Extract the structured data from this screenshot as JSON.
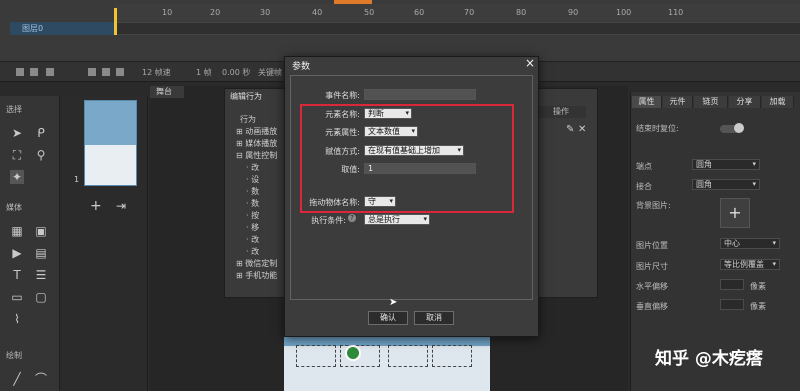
{
  "timeline": {
    "ticks": [
      "10",
      "20",
      "30",
      "40",
      "50",
      "60",
      "70",
      "80",
      "90",
      "100",
      "110"
    ],
    "layer_label": "图层0",
    "keyframe_color": "#f2c230",
    "bar": {
      "frames": "12 帧速",
      "current": "1 帧",
      "time": "0.00 秒",
      "keyframe_label": "关键帧"
    }
  },
  "left_tools": {
    "section_select": "选择",
    "section_media": "媒体",
    "section_draw": "绘制"
  },
  "pages": {
    "page_number": "1"
  },
  "canvas": {
    "tab_label": "舞台"
  },
  "behavior_editor": {
    "title": "编辑行为",
    "title_prefix": "行为",
    "tree": [
      "动画播放",
      "媒体播放",
      "属性控制",
      "改",
      "设",
      "数",
      "数",
      "按",
      "移",
      "改",
      "改",
      "固",
      "微信定制",
      "手机功能"
    ],
    "op_label": "操作"
  },
  "right_panel": {
    "tabs": [
      "属性",
      "元件",
      "链页",
      "分享",
      "加载"
    ],
    "rows": {
      "pos_label": "结束时复位:",
      "corner_label": "端点",
      "corner_value": "圆角",
      "join_label": "接合",
      "join_value": "圆角",
      "bg_label": "背景图片:",
      "bg_add": "+",
      "img_pos_label": "图片位置",
      "img_pos_value": "中心",
      "img_size_label": "图片尺寸",
      "img_size_value": "等比例覆盖",
      "hoffset_label": "水平偏移",
      "voffset_label": "垂直偏移",
      "unit": "像素"
    }
  },
  "modal": {
    "title": "参数",
    "close": "×",
    "event_name_label": "事件名称:",
    "event_name_value": "",
    "element_name_label": "元素名称:",
    "element_name_value": "判断",
    "element_prop_label": "元素属性:",
    "element_prop_value": "文本数值",
    "assign_label": "赋值方式:",
    "assign_value": "在现有值基础上增加",
    "value_label": "取值:",
    "value_value": "1",
    "drag_label": "拖动物体名称:",
    "drag_value": "守",
    "cond_label": "执行条件:",
    "cond_help": "?",
    "cond_value": "总是执行",
    "ok": "确认",
    "cancel": "取消",
    "highlight_color": "#d8283a"
  },
  "watermark": "知乎 @木疙瘩"
}
